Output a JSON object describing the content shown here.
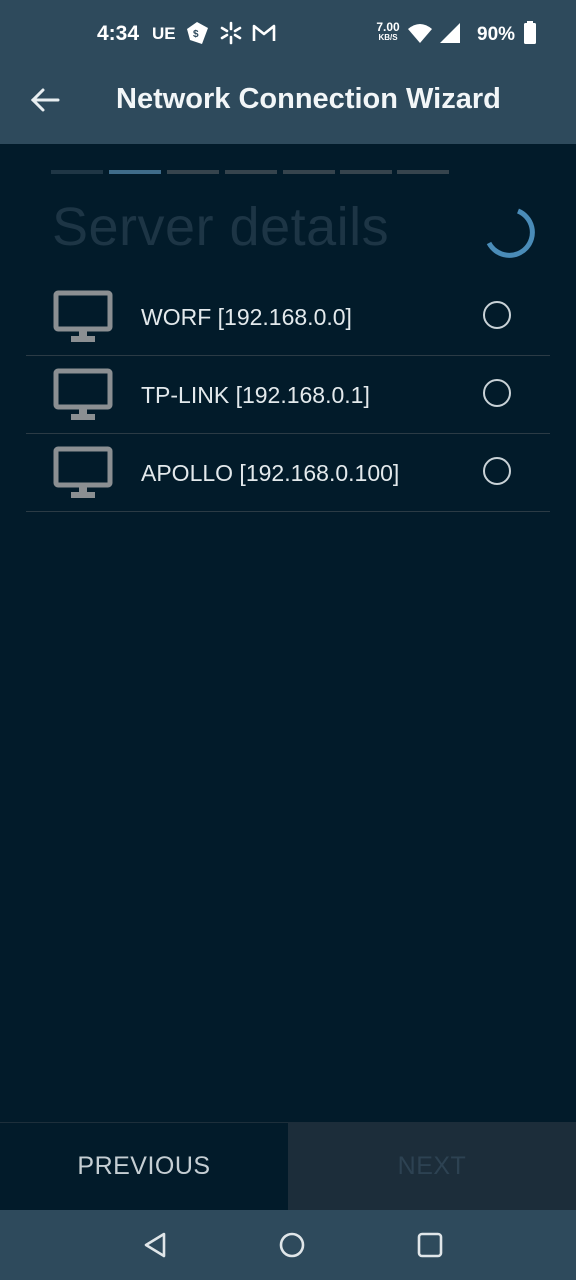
{
  "status_bar": {
    "time": "4:34",
    "carrier": "UE",
    "net_speed_value": "7.00",
    "net_speed_unit": "KB/S",
    "battery": "90%",
    "icons": [
      "tag-icon",
      "asterisk-icon",
      "gmail-icon",
      "wifi-icon",
      "signal-icon",
      "battery-icon"
    ]
  },
  "app_bar": {
    "title": "Network Connection Wizard",
    "back_icon": "back-arrow-icon"
  },
  "wizard": {
    "step_count": 7,
    "current_step": 2,
    "section_title": "Server details",
    "loading": true
  },
  "servers": [
    {
      "name": "WORF [192.168.0.0]",
      "icon": "monitor-icon",
      "selected": false
    },
    {
      "name": "TP-LINK [192.168.0.1]",
      "icon": "monitor-icon",
      "selected": false
    },
    {
      "name": "APOLLO [192.168.0.100]",
      "icon": "monitor-icon",
      "selected": false
    }
  ],
  "buttons": {
    "previous": "PREVIOUS",
    "next": "NEXT"
  },
  "nav_bar": {
    "icons": [
      "nav-back-icon",
      "nav-home-icon",
      "nav-recents-icon"
    ]
  },
  "colors": {
    "background": "#021b2a",
    "bar": "#2e4a5c",
    "accent": "#4a8cb8"
  }
}
